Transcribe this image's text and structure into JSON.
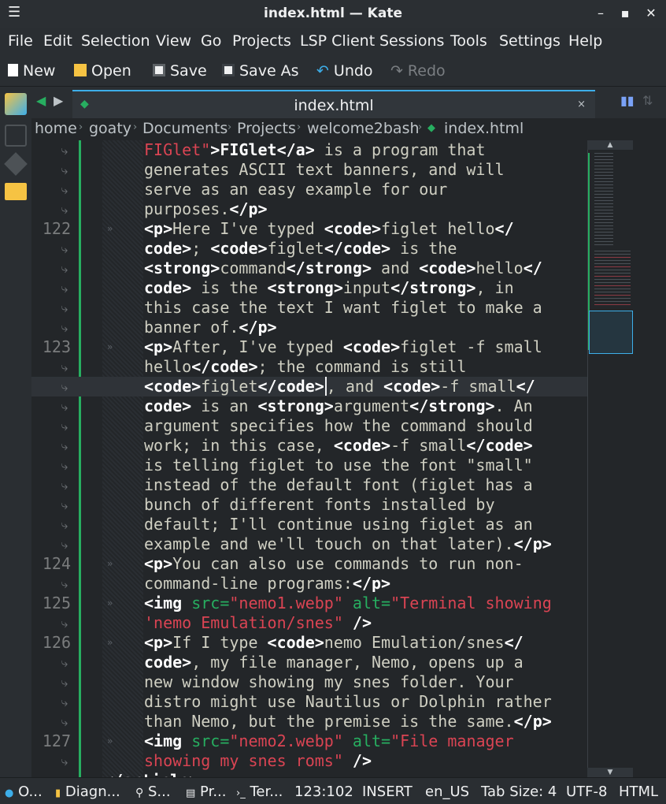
{
  "window": {
    "title": "index.html  — Kate"
  },
  "menubar": [
    "File",
    "Edit",
    "Selection",
    "View",
    "Go",
    "Projects",
    "LSP Client",
    "Sessions",
    "Tools",
    "Settings",
    "Help"
  ],
  "toolbar": {
    "new": "New",
    "open": "Open",
    "save": "Save",
    "save_as": "Save As",
    "undo": "Undo",
    "redo": "Redo"
  },
  "tab": {
    "title": "index.html",
    "close": "×"
  },
  "breadcrumb": [
    "home",
    "goaty",
    "Documents",
    "Projects",
    "welcome2bash",
    "index.html"
  ],
  "editor": {
    "wrap_glyph": "⤷",
    "fold_glyph": "»",
    "line_numbers": {
      "l122": "122",
      "l123": "123",
      "l124": "124",
      "l125": "125",
      "l126": "126",
      "l127": "127"
    },
    "code": {
      "r0a": "FIGlet\"",
      "r0b": ">FIGlet",
      "r0c": "</a>",
      "r0d": " is a program that",
      "r1": "generates ASCII text banners, and will",
      "r2": "serve as an easy example for our",
      "r3a": "purposes.",
      "r3b": "</p>",
      "r4a": "<p>",
      "r4b": "Here I've typed ",
      "r4c": "<code>",
      "r4d": "figlet hello",
      "r4e": "</",
      "r5a": "code>",
      "r5b": "; ",
      "r5c": "<code>",
      "r5d": "figlet",
      "r5e": "</code>",
      "r5f": " is the",
      "r6a": "<strong>",
      "r6b": "command",
      "r6c": "</strong>",
      "r6d": " and ",
      "r6e": "<code>",
      "r6f": "hello",
      "r6g": "</",
      "r7a": "code>",
      "r7b": " is the ",
      "r7c": "<strong>",
      "r7d": "input",
      "r7e": "</strong>",
      "r7f": ", in",
      "r8": "this case the text I want figlet to make a",
      "r9a": "banner of.",
      "r9b": "</p>",
      "r10a": "<p>",
      "r10b": "After, I've typed ",
      "r10c": "<code>",
      "r10d": "figlet -f small",
      "r11a": "hello",
      "r11b": "</code>",
      "r11c": "; the command is still",
      "r12a": "<code>",
      "r12b": "figlet",
      "r12c": "</code>",
      "r12d": ", and ",
      "r12e": "<code>",
      "r12f": "-f small",
      "r12g": "</",
      "r13a": "code>",
      "r13b": " is an ",
      "r13c": "<strong>",
      "r13d": "argument",
      "r13e": "</strong>",
      "r13f": ". An",
      "r14": "argument specifies how the command should",
      "r15a": "work; in this case, ",
      "r15b": "<code>",
      "r15c": "-f small",
      "r15d": "</code>",
      "r16": "is telling figlet to use the font \"small\"",
      "r17": "instead of the default font (figlet has a",
      "r18": "bunch of different fonts installed by",
      "r19": "default; I'll continue using figlet as an",
      "r20a": "example and we'll touch on that later).",
      "r20b": "</p>",
      "r21a": "<p>",
      "r21b": "You can also use commands to run non-",
      "r22a": "command-line programs:",
      "r22b": "</p>",
      "r23a": "<img ",
      "r23b": "src=",
      "r23c": "\"nemo1.webp\"",
      "r23d": " alt=",
      "r23e": "\"Terminal showing",
      "r24a": "'nemo Emulation/snes\"",
      "r24b": " />",
      "r25a": "<p>",
      "r25b": "If I type ",
      "r25c": "<code>",
      "r25d": "nemo Emulation/snes",
      "r25e": "</",
      "r26a": "code>",
      "r26b": ", my file manager, Nemo, opens up a",
      "r27": "new window showing my snes folder. Your",
      "r28": "distro might use Nautilus or Dolphin rather",
      "r29a": "than Nemo, but the premise is the same.",
      "r29b": "</p>",
      "r30a": "<img ",
      "r30b": "src=",
      "r30c": "\"nemo2.webp\"",
      "r30d": " alt=",
      "r30e": "\"File manager",
      "r31a": "showing my snes roms\"",
      "r31b": " />",
      "r32": "</article>"
    }
  },
  "statusbar": {
    "outline": "O...",
    "diagnostics": "Diagn...",
    "search": "S...",
    "projects": "Pr...",
    "terminal": "Ter...",
    "cursor": "123:102",
    "mode": "INSERT",
    "language": "en_US",
    "tab_size": "Tab Size: 4",
    "encoding": "UTF-8",
    "syntax": "HTML"
  },
  "colors": {
    "accent": "#3daee9",
    "modified": "#27ae60",
    "string": "#da4453",
    "attribute": "#27ae60"
  }
}
